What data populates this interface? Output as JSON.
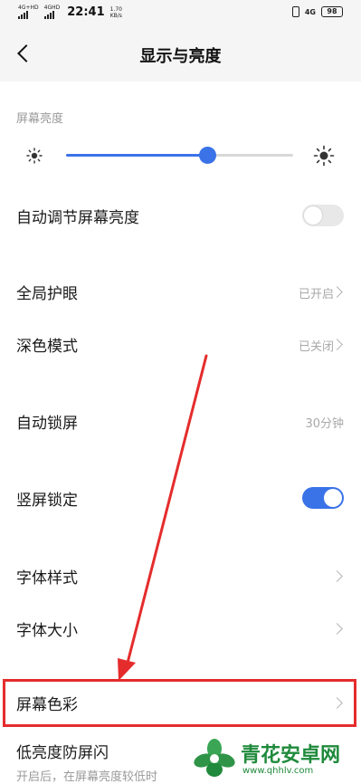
{
  "status_bar": {
    "sim1_label": "4G+HD",
    "sim2_label": "4GHD",
    "time": "22:41",
    "speed_value": "1.70",
    "speed_unit": "KB/s",
    "network": "4G",
    "battery": "98"
  },
  "header": {
    "title": "显示与亮度"
  },
  "brightness": {
    "section_label": "屏幕亮度",
    "level_percent": 62
  },
  "rows": [
    {
      "label": "自动调节屏幕亮度",
      "control": "toggle",
      "on": false
    },
    {
      "label": "全局护眼",
      "value": "已开启",
      "control": "chevron"
    },
    {
      "label": "深色模式",
      "value": "已关闭",
      "control": "chevron"
    },
    {
      "label": "自动锁屏",
      "value": "30分钟",
      "control": "none"
    },
    {
      "label": "竖屏锁定",
      "control": "toggle",
      "on": true
    },
    {
      "label": "字体样式",
      "control": "chevron"
    },
    {
      "label": "字体大小",
      "control": "chevron"
    },
    {
      "label": "屏幕色彩",
      "control": "chevron"
    },
    {
      "label": "低亮度防屏闪",
      "control": "none"
    }
  ],
  "low_flicker_description": "开启后，在屏幕亮度较低时",
  "watermark": {
    "name": "青花安卓网",
    "url": "www.qhhlv.com"
  },
  "colors": {
    "accent": "#3a72e8",
    "annotation": "#e52c2c",
    "watermark": "#1f8a3b"
  }
}
